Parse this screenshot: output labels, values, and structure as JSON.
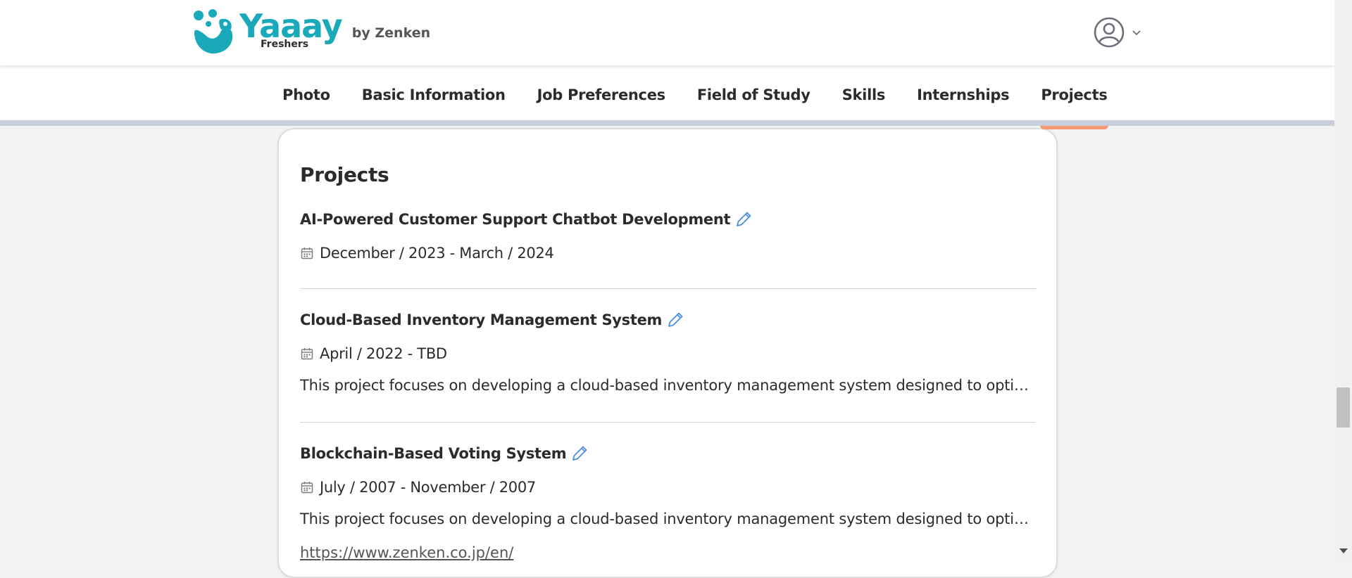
{
  "header": {
    "logo_word": "Yaaay",
    "logo_sub": "Freshers",
    "logo_by": "by Zenken",
    "account_icon": "user-circle-icon",
    "account_chevron": "chevron-down-icon"
  },
  "tabs": [
    {
      "label": "Photo",
      "active": false
    },
    {
      "label": "Basic Information",
      "active": false
    },
    {
      "label": "Job Preferences",
      "active": false
    },
    {
      "label": "Field of Study",
      "active": false
    },
    {
      "label": "Skills",
      "active": false
    },
    {
      "label": "Internships",
      "active": false
    },
    {
      "label": "Projects",
      "active": true
    }
  ],
  "section": {
    "title": "Projects",
    "projects": [
      {
        "title": "AI-Powered Customer Support Chatbot Development",
        "date": "December / 2023 - March / 2024"
      },
      {
        "title": "Cloud-Based Inventory Management System",
        "date": "April / 2022 - TBD",
        "description": "This project focuses on developing a cloud-based inventory management system designed to optimi..."
      },
      {
        "title": "Blockchain-Based Voting System",
        "date": "July / 2007 - November / 2007",
        "description": "This project focuses on developing a cloud-based inventory management system designed to optimi...",
        "link": "https://www.zenken.co.jp/en/"
      }
    ]
  },
  "colors": {
    "brand": "#19a9b8",
    "tab_active_indicator": "#f79874",
    "edit_icon": "#4a8fe0",
    "tab_rule": "#c9cfda"
  }
}
